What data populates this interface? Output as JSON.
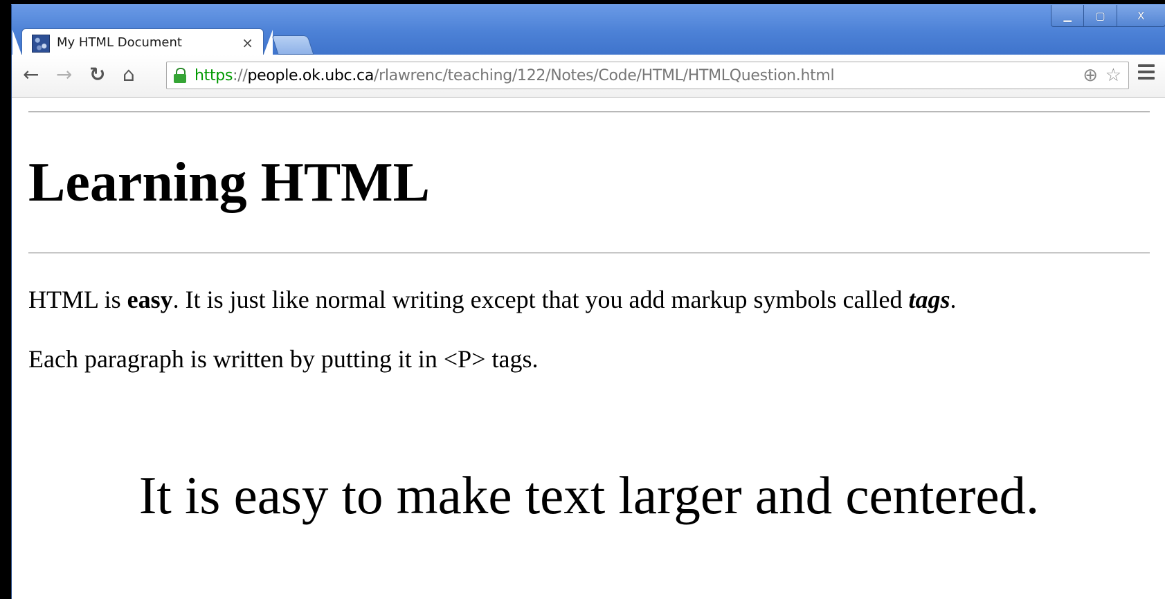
{
  "window": {
    "controls": {
      "minimize": "▁",
      "maximize": "▢",
      "close": "X"
    }
  },
  "tab": {
    "title": "My HTML Document",
    "close": "×",
    "favicon": "page-favicon"
  },
  "toolbar": {
    "back": "←",
    "forward": "→",
    "reload": "↻",
    "home": "⌂",
    "zoom": "⊕",
    "star": "☆"
  },
  "omnibox": {
    "scheme": "https",
    "separator": "://",
    "host": "people.ok.ubc.ca",
    "path": "/rlawrenc/teaching/122/Notes/Code/HTML/HTMLQuestion.html"
  },
  "page": {
    "heading": "Learning HTML",
    "para1": {
      "part1": "HTML is ",
      "bold": "easy",
      "part2": ". It is just like normal writing except that you add markup symbols called ",
      "bold_italic": "tags",
      "part3": "."
    },
    "para2": "Each paragraph is written by putting it in <P> tags.",
    "big_text": "It is easy to make text larger and centered."
  },
  "colors": {
    "titlebar": "#4d82d4",
    "secure_scheme": "#009900",
    "url_path": "#777777"
  }
}
